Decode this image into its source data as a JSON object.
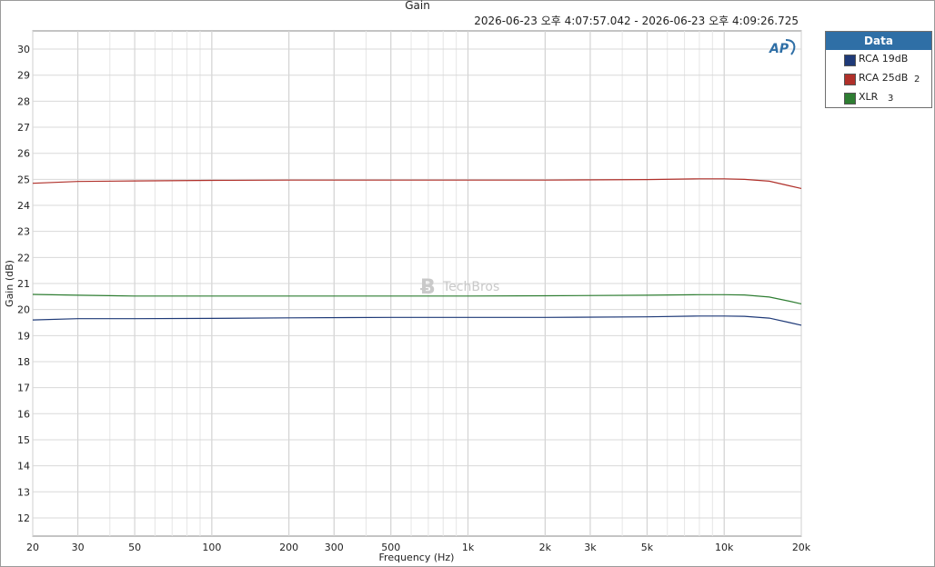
{
  "chart_data": {
    "type": "line",
    "title": "Gain",
    "subtitle": "2026-06-23 오후 4:07:57.042 - 2026-06-23 오후 4:09:26.725",
    "xlabel": "Frequency (Hz)",
    "ylabel": "Gain (dB)",
    "xscale": "log",
    "xlim": [
      20,
      20000
    ],
    "ylim": [
      11.3,
      30.7
    ],
    "grid": true,
    "x_ticks": [
      {
        "v": 20,
        "label": "20"
      },
      {
        "v": 30,
        "label": "30"
      },
      {
        "v": 50,
        "label": "50"
      },
      {
        "v": 100,
        "label": "100"
      },
      {
        "v": 200,
        "label": "200"
      },
      {
        "v": 300,
        "label": "300"
      },
      {
        "v": 500,
        "label": "500"
      },
      {
        "v": 1000,
        "label": "1k"
      },
      {
        "v": 2000,
        "label": "2k"
      },
      {
        "v": 3000,
        "label": "3k"
      },
      {
        "v": 5000,
        "label": "5k"
      },
      {
        "v": 10000,
        "label": "10k"
      },
      {
        "v": 20000,
        "label": "20k"
      }
    ],
    "y_ticks": [
      12,
      13,
      14,
      15,
      16,
      17,
      18,
      19,
      20,
      21,
      22,
      23,
      24,
      25,
      26,
      27,
      28,
      29,
      30
    ],
    "legend_title": "Data",
    "legend_position": "right",
    "series": [
      {
        "name": "RCA 19dB",
        "suffix": "",
        "color": "#1f3a78",
        "x": [
          20,
          30,
          50,
          100,
          200,
          500,
          1000,
          2000,
          5000,
          8000,
          10000,
          12000,
          15000,
          18000,
          20000
        ],
        "y": [
          19.6,
          19.65,
          19.65,
          19.66,
          19.68,
          19.7,
          19.7,
          19.7,
          19.72,
          19.75,
          19.75,
          19.74,
          19.67,
          19.5,
          19.4
        ]
      },
      {
        "name": "RCA 25dB",
        "suffix": "2",
        "color": "#b0302a",
        "x": [
          20,
          30,
          50,
          100,
          200,
          500,
          1000,
          2000,
          5000,
          8000,
          10000,
          12000,
          15000,
          18000,
          20000
        ],
        "y": [
          24.85,
          24.92,
          24.94,
          24.96,
          24.97,
          24.97,
          24.97,
          24.97,
          24.99,
          25.02,
          25.02,
          25.0,
          24.93,
          24.75,
          24.65
        ]
      },
      {
        "name": "XLR",
        "suffix": "3",
        "color": "#2e7d32",
        "x": [
          20,
          30,
          50,
          100,
          200,
          500,
          1000,
          2000,
          5000,
          8000,
          10000,
          12000,
          15000,
          18000,
          20000
        ],
        "y": [
          20.58,
          20.55,
          20.52,
          20.52,
          20.52,
          20.52,
          20.52,
          20.53,
          20.55,
          20.57,
          20.57,
          20.56,
          20.48,
          20.32,
          20.22
        ]
      }
    ],
    "watermark": "TechBros",
    "logo": "AP"
  }
}
